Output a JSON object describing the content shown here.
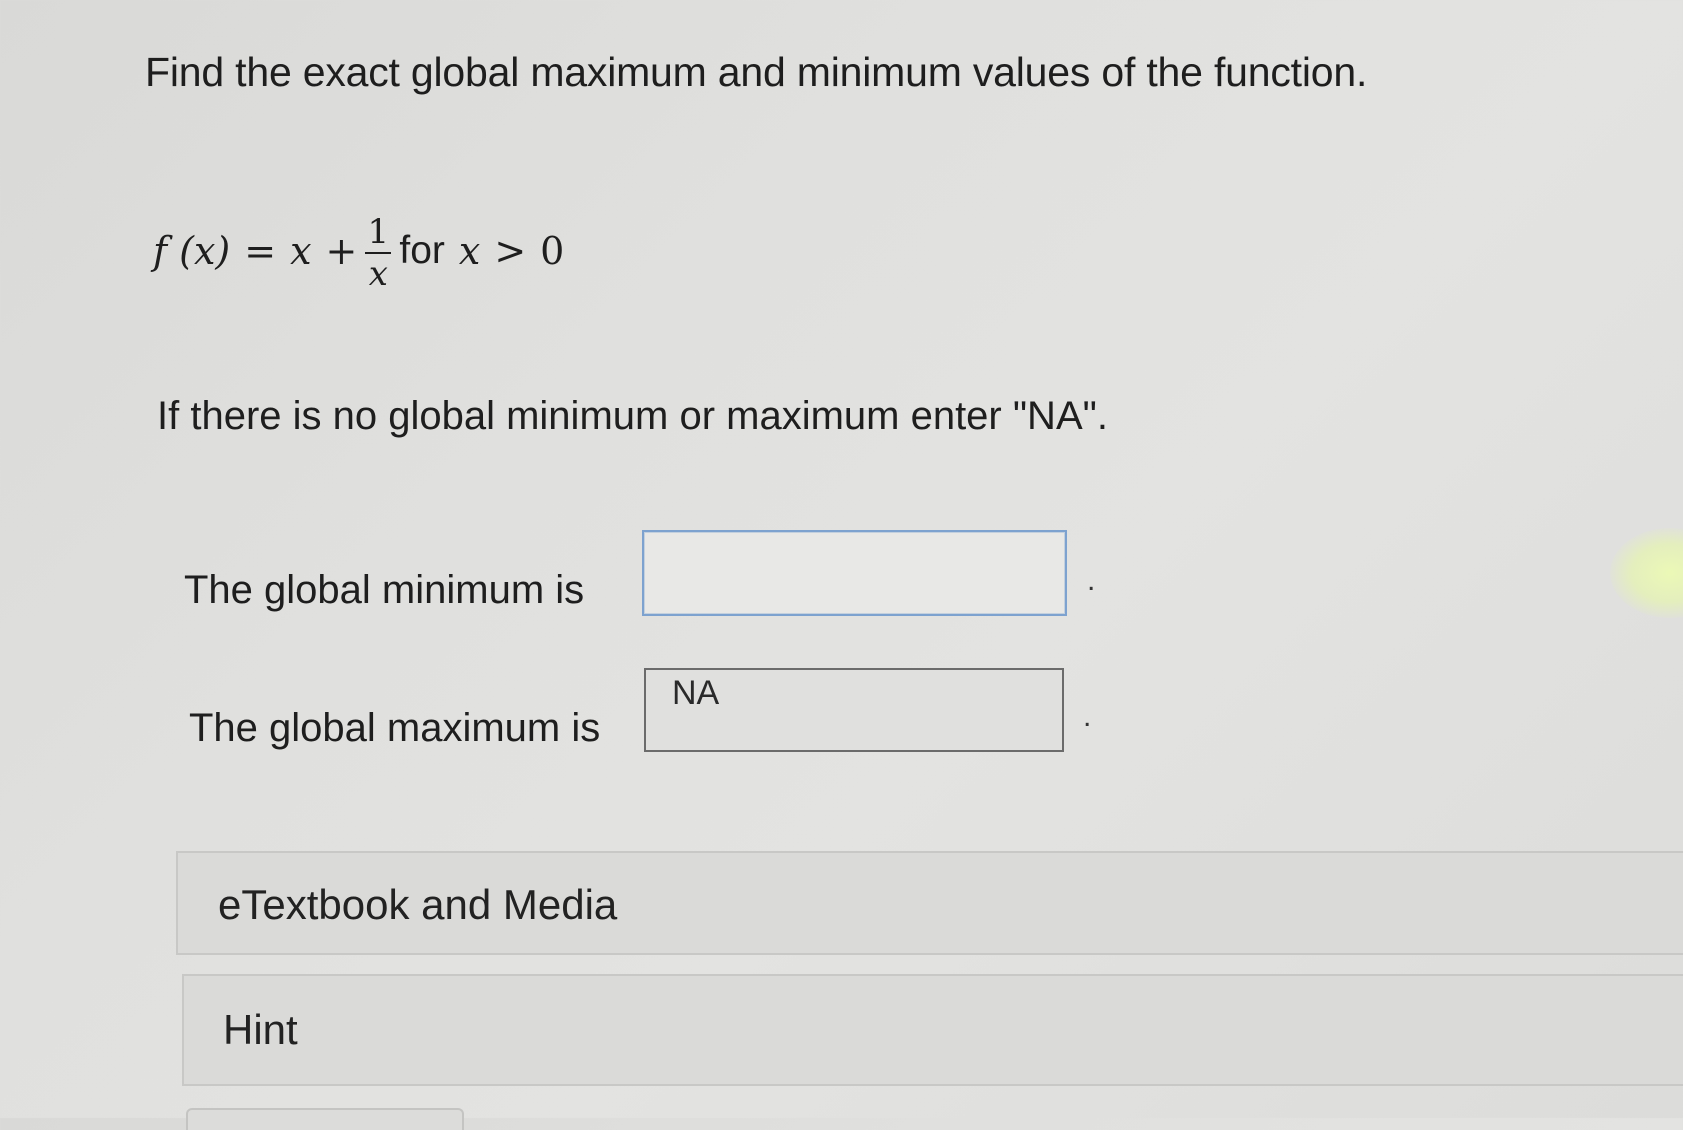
{
  "question": {
    "title": "Find the exact global maximum and minimum values of the function.",
    "formula": {
      "lhs": "f (x)",
      "equals": "=",
      "var": "x",
      "plus": "+",
      "numerator": "1",
      "denominator": "x",
      "for_word": "for",
      "cond_var": "x",
      "cond_op": ">",
      "cond_value": "0"
    },
    "instruction": "If there is no global minimum or maximum enter \"NA\"."
  },
  "answers": {
    "minimum": {
      "label": "The global minimum is",
      "value": "",
      "placeholder": "",
      "suffix": "."
    },
    "maximum": {
      "label": "The global maximum is",
      "value": "NA",
      "placeholder": "",
      "suffix": "."
    }
  },
  "resources": {
    "etextbook_label": "eTextbook and Media",
    "hint_label": "Hint"
  },
  "colors": {
    "focus_border": "#7da2cf",
    "filled_border": "#6b6b6b",
    "background": "#e0e0de"
  }
}
